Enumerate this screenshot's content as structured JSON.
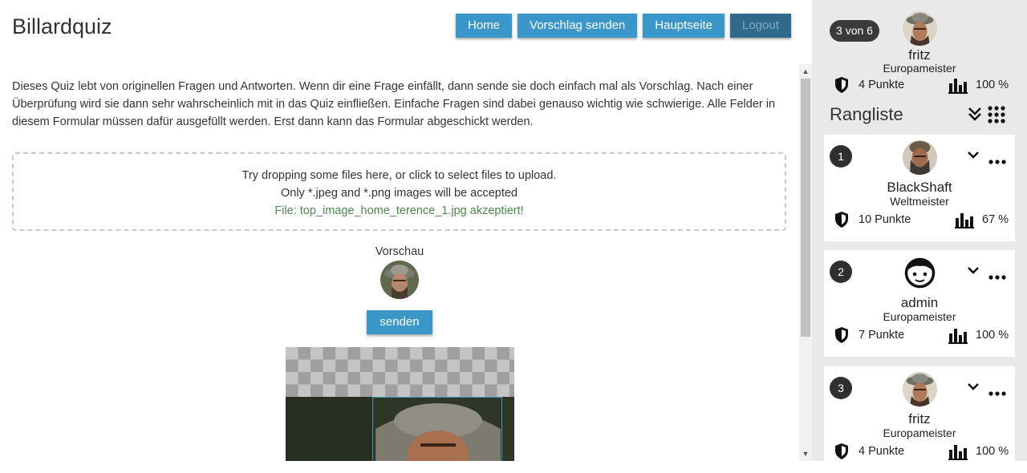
{
  "app": {
    "title": "Billardquiz"
  },
  "nav": {
    "home": "Home",
    "suggest": "Vorschlag senden",
    "main": "Hauptseite",
    "logout": "Logout"
  },
  "intro": "Dieses Quiz lebt von originellen Fragen und Antworten. Wenn dir eine Frage einfällt, dann sende sie doch einfach mal als Vorschlag. Nach einer Überprüfung wird sie dann sehr wahrscheinlich mit in das Quiz einfließen. Einfache Fragen sind dabei genauso wichtig wie schwierige. Alle Felder in diesem Formular müssen dafür ausgefüllt werden. Erst dann kann das Formular abgeschickt werden.",
  "dropzone": {
    "line1": "Try dropping some files here, or click to select files to upload.",
    "line2": "Only *.jpeg and *.png images will be accepted",
    "accepted": "File: top_image_home_terence_1.jpg akzeptiert!"
  },
  "preview": {
    "label": "Vorschau",
    "send": "senden"
  },
  "current_user": {
    "position": "3 von 6",
    "name": "fritz",
    "rank": "Europameister",
    "points": "4 Punkte",
    "percent": "100 %",
    "avatar_icon": "user-photo-icon"
  },
  "ranking": {
    "title": "Rangliste",
    "entries": [
      {
        "place": "1",
        "name": "BlackShaft",
        "rank": "Weltmeister",
        "points": "10 Punkte",
        "percent": "67 %",
        "avatar_icon": "user-photo-icon"
      },
      {
        "place": "2",
        "name": "admin",
        "rank": "Europameister",
        "points": "7 Punkte",
        "percent": "100 %",
        "avatar_icon": "default-face-icon"
      },
      {
        "place": "3",
        "name": "fritz",
        "rank": "Europameister",
        "points": "4 Punkte",
        "percent": "100 %",
        "avatar_icon": "user-photo-icon"
      }
    ]
  },
  "colors": {
    "accent": "#3b97c9",
    "logout": "#2e6a8c",
    "sidebar": "#e9e9e9",
    "accepted_text": "#4a8a4a"
  }
}
